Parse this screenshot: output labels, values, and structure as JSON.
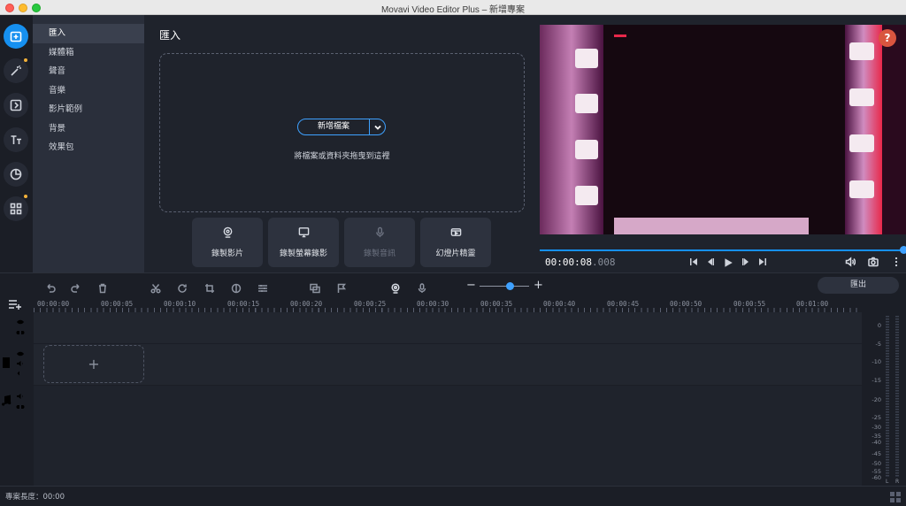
{
  "window": {
    "title": "Movavi Video Editor Plus – 新增專案"
  },
  "rail": {
    "items": [
      {
        "name": "import-icon",
        "active": true
      },
      {
        "name": "magic-wand-icon",
        "active": false,
        "dot": true
      },
      {
        "name": "transitions-icon",
        "active": false
      },
      {
        "name": "titles-icon",
        "active": false
      },
      {
        "name": "stickers-icon",
        "active": false
      },
      {
        "name": "more-tools-icon",
        "active": false,
        "dot": true
      }
    ]
  },
  "categories": [
    "匯入",
    "媒體箱",
    "聲音",
    "音樂",
    "影片範例",
    "背景",
    "效果包"
  ],
  "import": {
    "title": "匯入",
    "add_file": "新增檔案",
    "drop_hint": "將檔案或資料夾拖曳到這裡",
    "buttons": [
      {
        "label": "錄製影片",
        "icon": "webcam-icon",
        "enabled": true
      },
      {
        "label": "錄製螢幕錄影",
        "icon": "screen-record-icon",
        "enabled": true
      },
      {
        "label": "錄製音訊",
        "icon": "microphone-icon",
        "enabled": false
      },
      {
        "label": "幻燈片精靈",
        "icon": "slideshow-icon",
        "enabled": true
      }
    ]
  },
  "preview": {
    "help": "?",
    "timecode_main": "00:00:08",
    "timecode_ms": ".008",
    "progress": 1.0
  },
  "toolbar": {
    "export_label": "匯出",
    "zoom_level": 0.6
  },
  "ruler": {
    "labels": [
      "00:00:00",
      "00:00:05",
      "00:00:10",
      "00:00:15",
      "00:00:20",
      "00:00:25",
      "00:00:30",
      "00:00:35",
      "00:00:40",
      "00:00:45",
      "00:00:50",
      "00:00:55",
      "00:01:00"
    ]
  },
  "meter": {
    "labels": [
      "0",
      "-5",
      "-10",
      "-15",
      "-20",
      "-25",
      "-30",
      "-35",
      "-40",
      "-45",
      "-50",
      "-55",
      "-60"
    ],
    "channels": [
      "L",
      "R"
    ]
  },
  "status": {
    "project_length": "專案長度：00:00"
  },
  "colors": {
    "accent": "#1690f0",
    "help": "#d9553f",
    "panel": "#2a2f3b"
  }
}
